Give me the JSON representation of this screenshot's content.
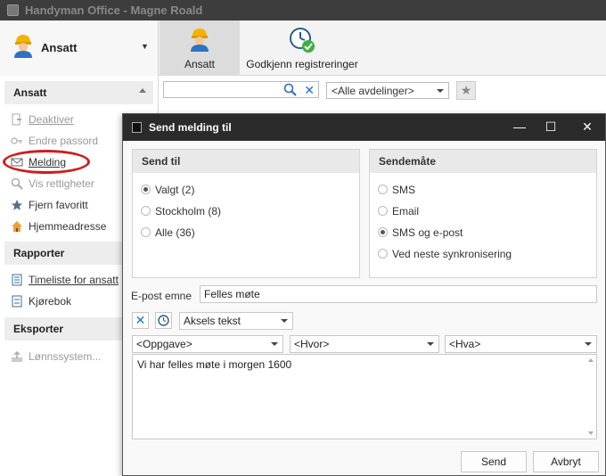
{
  "window": {
    "title": "Handyman Office - Magne Roald"
  },
  "ribbon": {
    "user_label": "Ansatt",
    "buttons": [
      {
        "label": "Ansatt",
        "icon": "worker-icon"
      },
      {
        "label": "Godkjenn registreringer",
        "icon": "clock-check-icon"
      }
    ]
  },
  "sidebar": {
    "sections": [
      {
        "title": "Ansatt",
        "items": [
          {
            "label": "Deaktiver",
            "icon": "deactivate-icon",
            "disabled": true
          },
          {
            "label": "Endre passord",
            "icon": "key-icon",
            "disabled": true
          },
          {
            "label": "Melding",
            "icon": "envelope-icon",
            "disabled": false
          },
          {
            "label": "Vis rettigheter",
            "icon": "magnifier-icon",
            "disabled": true
          },
          {
            "label": "Fjern favoritt",
            "icon": "star-icon",
            "disabled": false
          },
          {
            "label": "Hjemmeadresse",
            "icon": "house-icon",
            "disabled": false
          }
        ]
      },
      {
        "title": "Rapporter",
        "items": [
          {
            "label": "Timeliste for ansatt",
            "icon": "timesheet-icon"
          },
          {
            "label": "Kjørebok",
            "icon": "logbook-icon"
          }
        ]
      },
      {
        "title": "Eksporter",
        "items": [
          {
            "label": "Lønnssystem...",
            "icon": "export-icon",
            "disabled": true
          }
        ]
      }
    ]
  },
  "main": {
    "search_value": "",
    "department_select": "<Alle avdelinger>"
  },
  "dialog": {
    "title": "Send melding til",
    "send_to": {
      "title": "Send til",
      "options": [
        {
          "label": "Valgt (2)",
          "selected": true
        },
        {
          "label": "Stockholm (8)",
          "selected": false
        },
        {
          "label": "Alle (36)",
          "selected": false
        }
      ]
    },
    "send_method": {
      "title": "Sendemåte",
      "options": [
        {
          "label": "SMS",
          "selected": false
        },
        {
          "label": "Email",
          "selected": false
        },
        {
          "label": "SMS og e-post",
          "selected": true
        },
        {
          "label": "Ved neste synkronisering",
          "selected": false
        }
      ]
    },
    "subject_label": "E-post emne",
    "subject_value": "Felles møte",
    "text_select": "Aksels tekst",
    "task_select": "<Oppgave>",
    "where_select": "<Hvor>",
    "what_select": "<Hva>",
    "message": "Vi har felles møte i morgen 1600",
    "send_label": "Send",
    "cancel_label": "Avbryt"
  },
  "colors": {
    "titlebar": "#3d3d3d",
    "dialog_titlebar": "#2b2b2b",
    "accent_blue": "#1a73c8",
    "highlight_red": "#d01c1c"
  }
}
